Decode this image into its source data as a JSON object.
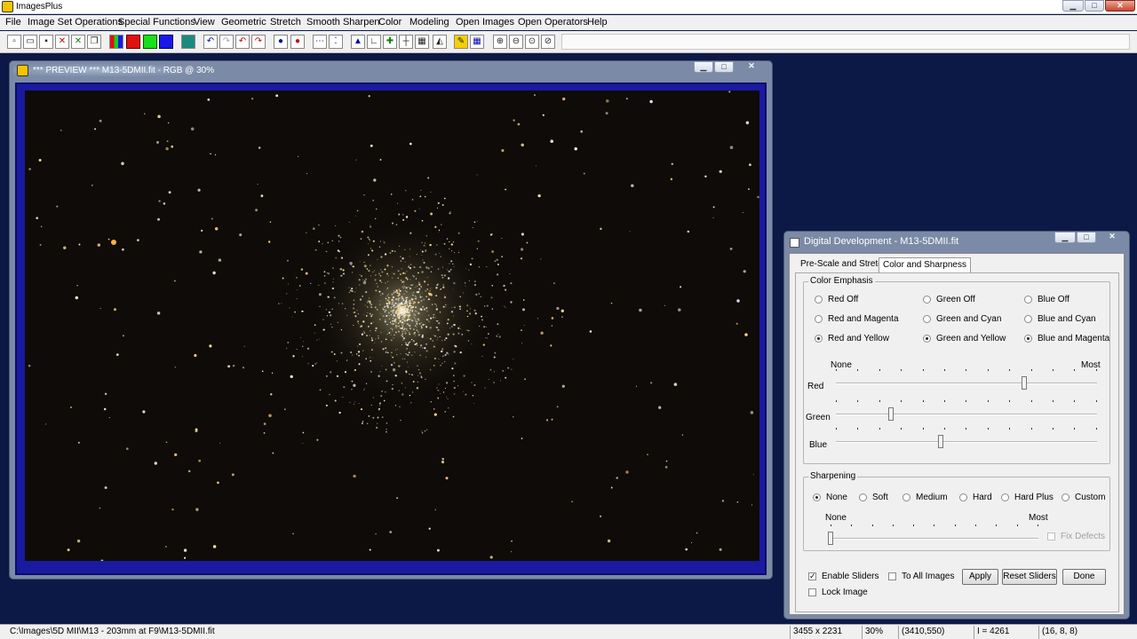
{
  "app": {
    "title": "ImagesPlus"
  },
  "menu": [
    "File",
    "Image Set Operations",
    "Special Functions",
    "View",
    "Geometric",
    "Stretch",
    "Smooth Sharpen",
    "Color",
    "Modeling",
    "Open Images",
    "Open Operators",
    "Help"
  ],
  "toolbar": {
    "icons": [
      "new-file-icon",
      "open-folder-icon",
      "save-icon",
      "close-red-x-icon",
      "close-green-x-icon",
      "copy-icon",
      "rgb-combine-icon",
      "red-channel-icon",
      "green-channel-icon",
      "blue-channel-icon",
      "image-set-icon",
      "undo-icon",
      "redo-icon",
      "undo-red-icon",
      "redo-red-icon",
      "record-icon",
      "stop-icon",
      "dots-icon",
      "points-icon",
      "histogram-icon",
      "levels-icon",
      "plus-icon",
      "crosshair-icon",
      "grid-icon",
      "image-edit-icon",
      "brush-icon",
      "table-icon",
      "zoom-in-icon",
      "zoom-out-icon",
      "zoom-fit-icon",
      "zoom-actual-icon"
    ]
  },
  "preview": {
    "title": "*** PREVIEW *** M13-5DMII.fit - RGB @ 30%"
  },
  "dialog": {
    "title": "Digital Development - M13-5DMII.fit",
    "tabs": [
      "Pre-Scale and Stretch",
      "Color and Sharpness"
    ],
    "active_tab": "Color and Sharpness",
    "color_emphasis": {
      "label": "Color Emphasis",
      "options": [
        [
          "Red Off",
          "Green Off",
          "Blue Off"
        ],
        [
          "Red and Magenta",
          "Green and Cyan",
          "Blue and Cyan"
        ],
        [
          "Red and Yellow",
          "Green and Yellow",
          "Blue and Magenta"
        ]
      ],
      "selected": [
        "Red and Yellow",
        "Green and Yellow",
        "Blue and Magenta"
      ],
      "scale_min": "None",
      "scale_max": "Most",
      "sliders": [
        {
          "label": "Red",
          "value": 0.72
        },
        {
          "label": "Green",
          "value": 0.21
        },
        {
          "label": "Blue",
          "value": 0.4
        }
      ]
    },
    "sharpening": {
      "label": "Sharpening",
      "options": [
        "None",
        "Soft",
        "Medium",
        "Hard",
        "Hard Plus",
        "Custom"
      ],
      "selected": "None",
      "scale_min": "None",
      "scale_max": "Most",
      "slider_value": 0.0,
      "fix_defects": "Fix Defects"
    },
    "enable_sliders": "Enable Sliders",
    "to_all_images": "To All Images",
    "lock_image": "Lock Image",
    "buttons": {
      "apply": "Apply",
      "reset": "Reset Sliders",
      "done": "Done"
    }
  },
  "status": {
    "path": "C:\\Images\\5D MII\\M13 - 203mm at F9\\M13-5DMII.fit",
    "size": "3455 x 2231",
    "zoom": "30%",
    "coords": "(3410,550)",
    "intensity": "I = 4261",
    "rgb": "(16, 8, 8)"
  }
}
